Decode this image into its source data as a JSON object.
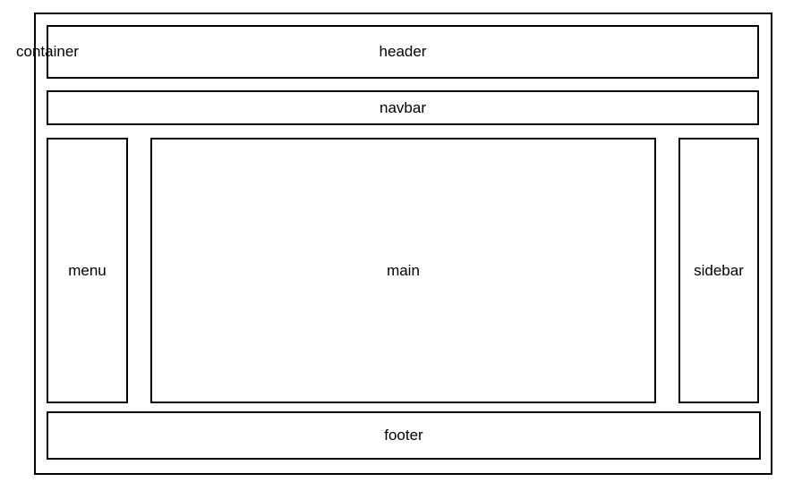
{
  "diagram": {
    "container_label": "container",
    "header_label": "header",
    "navbar_label": "navbar",
    "menu_label": "menu",
    "main_label": "main",
    "sidebar_label": "sidebar",
    "footer_label": "footer"
  }
}
